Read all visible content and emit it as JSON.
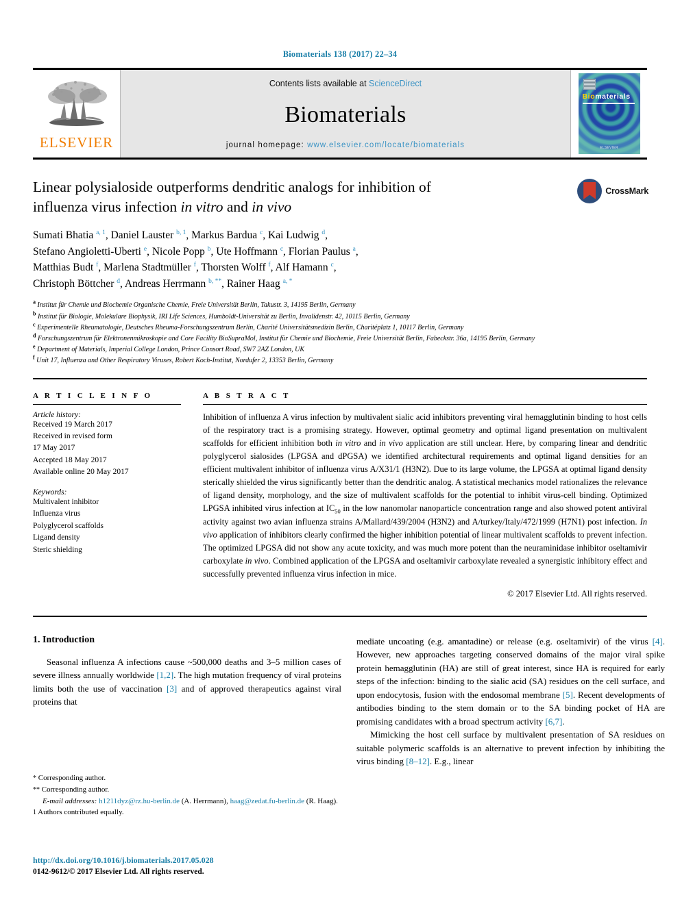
{
  "running_head": "Biomaterials 138 (2017) 22–34",
  "masthead": {
    "contents_prefix": "Contents lists available at ",
    "contents_link": "ScienceDirect",
    "journal_name": "Biomaterials",
    "homepage_label": "journal homepage: ",
    "homepage_url": "www.elsevier.com/locate/biomaterials",
    "publisher_wordmark": "ELSEVIER",
    "cover_title_bio": "Bio",
    "cover_title_rest": "materials",
    "cover_footer": "ELSEVIER"
  },
  "title": {
    "line1": "Linear polysialoside outperforms dendritic analogs for inhibition of",
    "line2_a": "influenza virus infection ",
    "line2_italic1": "in vitro",
    "line2_b": " and ",
    "line2_italic2": "in vivo",
    "crossmark_label": "CrossMark"
  },
  "authors_html": "Sumati Bhatia <sup>a, 1</sup>, Daniel Lauster <sup>b, 1</sup>, Markus Bardua <sup>c</sup>, Kai Ludwig <sup>d</sup>,<br>Stefano Angioletti-Uberti <sup>e</sup>, Nicole Popp <sup>b</sup>, Ute Hoffmann <sup>c</sup>, Florian Paulus <sup>a</sup>,<br>Matthias Budt <sup>f</sup>, Marlena Stadtmüller <sup>f</sup>, Thorsten Wolff <sup>f</sup>, Alf Hamann <sup>c</sup>,<br>Christoph Böttcher <sup>d</sup>, Andreas Herrmann <sup>b, **</sup>, Rainer Haag <sup>a, *</sup>",
  "affiliations": [
    {
      "mark": "a",
      "text": "Institut für Chemie und Biochemie Organische Chemie, Freie Universität Berlin, Takustr. 3, 14195 Berlin, Germany"
    },
    {
      "mark": "b",
      "text": "Institut für Biologie, Molekulare Biophysik, IRI Life Sciences, Humboldt-Universität zu Berlin, Invalidenstr. 42, 10115 Berlin, Germany"
    },
    {
      "mark": "c",
      "text": "Experimentelle Rheumatologie, Deutsches Rheuma-Forschungszentrum Berlin, Charité Universitätsmedizin Berlin, Charitéplatz 1, 10117 Berlin, Germany"
    },
    {
      "mark": "d",
      "text": "Forschungszentrum für Elektronenmikroskopie and Core Facility BioSupraMol, Institut für Chemie und Biochemie, Freie Universität Berlin, Fabeckstr. 36a, 14195 Berlin, Germany"
    },
    {
      "mark": "e",
      "text": "Department of Materials, Imperial College London, Prince Consort Road, SW7 2AZ London, UK"
    },
    {
      "mark": "f",
      "text": "Unit 17, Influenza and Other Respiratory Viruses, Robert Koch-Institut, Nordufer 2, 13353 Berlin, Germany"
    }
  ],
  "article_info": {
    "heading": "A R T I C L E   I N F O",
    "history_label": "Article history:",
    "history": [
      "Received 19 March 2017",
      "Received in revised form",
      "17 May 2017",
      "Accepted 18 May 2017",
      "Available online 20 May 2017"
    ],
    "keywords_label": "Keywords:",
    "keywords": [
      "Multivalent inhibitor",
      "Influenza virus",
      "Polyglycerol scaffolds",
      "Ligand density",
      "Steric shielding"
    ]
  },
  "abstract": {
    "heading": "A B S T R A C T",
    "body_html": "Inhibition of influenza A virus infection by multivalent sialic acid inhibitors preventing viral hemagglutinin binding to host cells of the respiratory tract is a promising strategy. However, optimal geometry and optimal ligand presentation on multivalent scaffolds for efficient inhibition both <i>in vitro</i> and <i>in vivo</i> application are still unclear. Here, by comparing linear and dendritic polyglycerol sialosides (LPGSA and dPGSA) we identified architectural requirements and optimal ligand densities for an efficient multivalent inhibitor of influenza virus A/X31/1 (H3N2). Due to its large volume, the LPGSA at optimal ligand density sterically shielded the virus significantly better than the dendritic analog. A statistical mechanics model rationalizes the relevance of ligand density, morphology, and the size of multivalent scaffolds for the potential to inhibit virus-cell binding. Optimized LPGSA inhibited virus infection at IC<sub>50</sub> in the low nanomolar nanoparticle concentration range and also showed potent antiviral activity against two avian influenza strains A/Mallard/439/2004 (H3N2) and A/turkey/Italy/472/1999 (H7N1) post infection. <i>In vivo</i> application of inhibitors clearly confirmed the higher inhibition potential of linear multivalent scaffolds to prevent infection. The optimized LPGSA did not show any acute toxicity, and was much more potent than the neuraminidase inhibitor oseltamivir carboxylate <i>in vivo</i>. Combined application of the LPGSA and oseltamivir carboxylate revealed a synergistic inhibitory effect and successfully prevented influenza virus infection in mice.",
    "copyright": "© 2017 Elsevier Ltd. All rights reserved."
  },
  "introduction": {
    "heading": "1. Introduction",
    "left_para_html": "Seasonal influenza A infections cause ~500,000 deaths and 3–5 million cases of severe illness annually worldwide <span class=\"ref\">[1,2]</span>. The high mutation frequency of viral proteins limits both the use of vaccination <span class=\"ref\">[3]</span> and of approved therapeutics against viral proteins that",
    "right_para1_html": "mediate uncoating (e.g. amantadine) or release (e.g. oseltamivir) of the virus <span class=\"ref\">[4]</span>. However, new approaches targeting conserved domains of the major viral spike protein hemagglutinin (HA) are still of great interest, since HA is required for early steps of the infection: binding to the sialic acid (SA) residues on the cell surface, and upon endocytosis, fusion with the endosomal membrane <span class=\"ref\">[5]</span>. Recent developments of antibodies binding to the stem domain or to the SA binding pocket of HA are promising candidates with a broad spectrum activity <span class=\"ref\">[6,7]</span>.",
    "right_para2_html": "Mimicking the host cell surface by multivalent presentation of SA residues on suitable polymeric scaffolds is an alternative to prevent infection by inhibiting the virus binding <span class=\"ref\">[8–12]</span>. E.g., linear"
  },
  "footnotes": {
    "line1_mark": "*",
    "line1_text": "Corresponding author.",
    "line2_mark": "**",
    "line2_text": "Corresponding author.",
    "email_label": "E-mail addresses:",
    "email1": "h1211dyz@rz.hu-berlin.de",
    "email1_owner": "(A. Herrmann),",
    "email2": "haag@zedat.fu-berlin.de",
    "email2_owner": "(R. Haag).",
    "line3_mark": "1",
    "line3_text": "Authors contributed equally."
  },
  "doi_block": {
    "doi": "http://dx.doi.org/10.1016/j.biomaterials.2017.05.028",
    "issn": "0142-9612/© 2017 Elsevier Ltd. All rights reserved."
  }
}
